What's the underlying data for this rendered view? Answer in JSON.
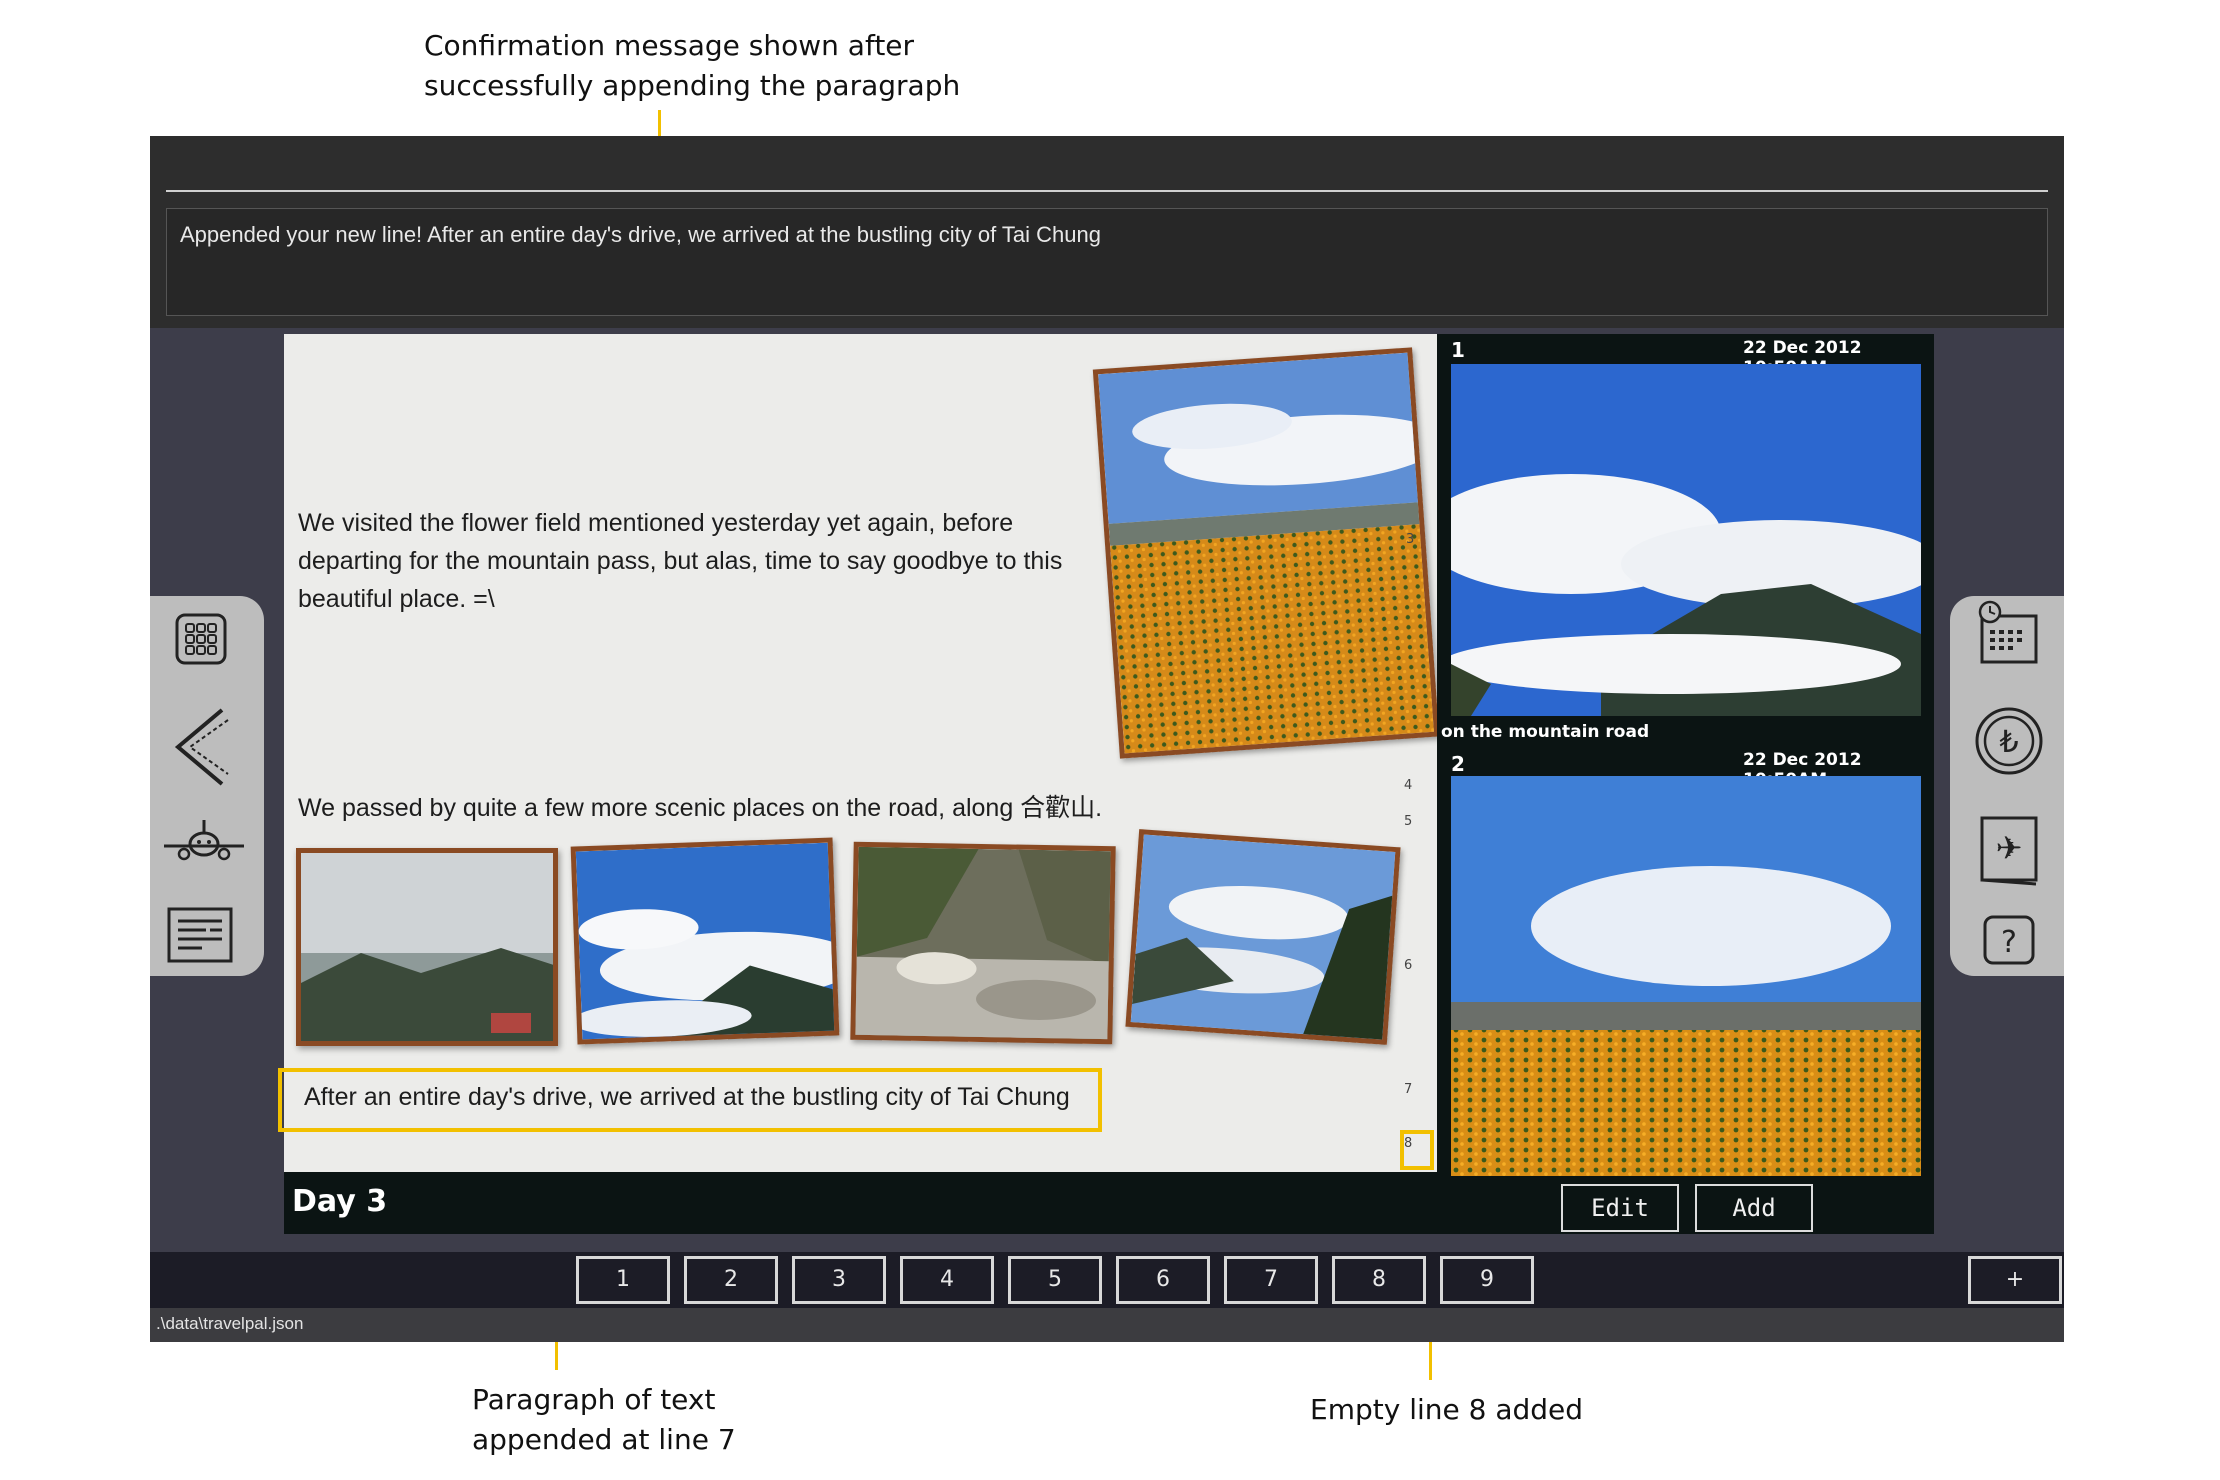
{
  "annotations": {
    "confirmation": "Confirmation message shown after\nsuccessfully appending the paragraph",
    "paragraph": "Paragraph of text\nappended at line 7",
    "empty_line": "Empty line 8 added"
  },
  "command": {
    "result_text": "Appended your new line!  After an entire day's drive, we arrived at the bustling city of Tai Chung"
  },
  "page": {
    "paragraph_1": "We visited the flower field mentioned yesterday yet again, before departing for the mountain pass, but alas, time to say goodbye to this beautiful place. =\\",
    "paragraph_2": "We passed by quite a few more scenic places on the road, along 合歡山.",
    "paragraph_appended": "After an entire day's drive, we arrived at the bustling city of Tai Chung",
    "line_numbers": [
      "3",
      "4",
      "5",
      "6",
      "7",
      "8"
    ],
    "day_title": "Day 3"
  },
  "photo_list": {
    "items": [
      {
        "number": "1",
        "date": "22 Dec 2012 10:50AM",
        "caption": "on the mountain road"
      },
      {
        "number": "2",
        "date": "22 Dec 2012 10:50AM",
        "caption": ""
      }
    ],
    "edit_label": "Edit",
    "add_label": "Add"
  },
  "pagination": {
    "pages": [
      "1",
      "2",
      "3",
      "4",
      "5",
      "6",
      "7",
      "8",
      "9"
    ],
    "add_label": "+"
  },
  "status": {
    "file_path": ".\\data\\travelpal.json"
  },
  "icons": {
    "left": [
      "grid-icon",
      "back-arrow-icon",
      "airplane-icon",
      "list-icon"
    ],
    "right": [
      "calendar-icon",
      "currency-icon",
      "travel-book-icon",
      "help-icon"
    ]
  },
  "colors": {
    "highlight": "#f2c000",
    "photo_frame": "#8a4a23"
  }
}
